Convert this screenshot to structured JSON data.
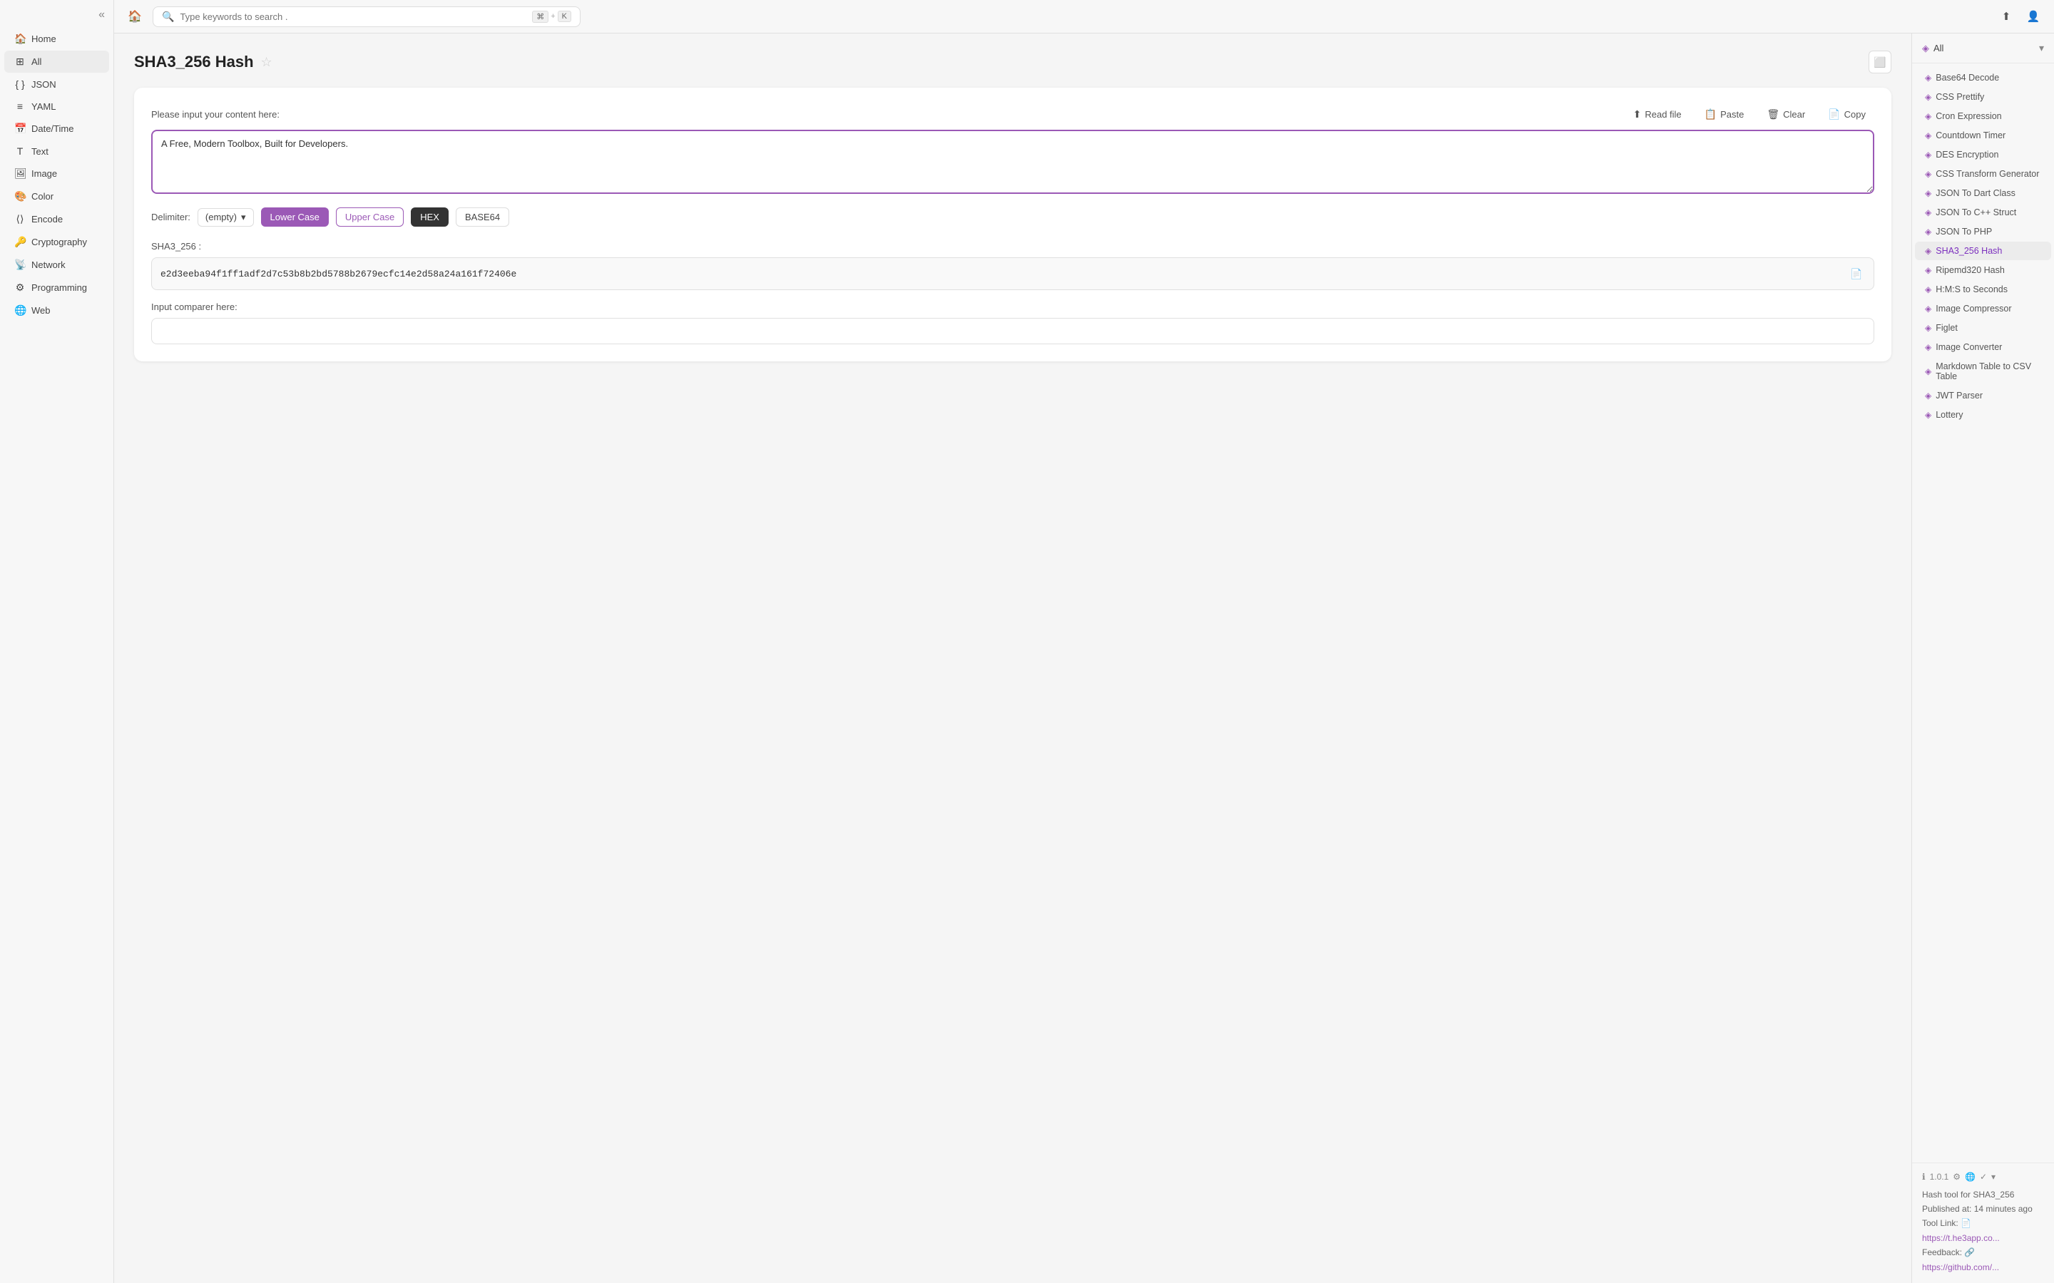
{
  "sidebar": {
    "items": [
      {
        "id": "home",
        "label": "Home",
        "icon": "🏠"
      },
      {
        "id": "all",
        "label": "All",
        "icon": "⊞",
        "active": true
      },
      {
        "id": "json",
        "label": "JSON",
        "icon": "{ }"
      },
      {
        "id": "yaml",
        "label": "YAML",
        "icon": "≡"
      },
      {
        "id": "datetime",
        "label": "Date/Time",
        "icon": "📅"
      },
      {
        "id": "text",
        "label": "Text",
        "icon": "T"
      },
      {
        "id": "image",
        "label": "Image",
        "icon": "🖼"
      },
      {
        "id": "color",
        "label": "Color",
        "icon": "🎨"
      },
      {
        "id": "encode",
        "label": "Encode",
        "icon": "⟨⟩"
      },
      {
        "id": "cryptography",
        "label": "Cryptography",
        "icon": "🔑"
      },
      {
        "id": "network",
        "label": "Network",
        "icon": "📡"
      },
      {
        "id": "programming",
        "label": "Programming",
        "icon": "⚙"
      },
      {
        "id": "web",
        "label": "Web",
        "icon": "🌐"
      }
    ]
  },
  "topbar": {
    "search_placeholder": "Type keywords to search .",
    "shortcut_symbol": "⌘",
    "shortcut_key": "K"
  },
  "tool": {
    "title": "SHA3_256 Hash",
    "input_label": "Please input your content here:",
    "input_value": "A Free, Modern Toolbox, Built for Developers.",
    "btn_read_file": "Read file",
    "btn_paste": "Paste",
    "btn_clear": "Clear",
    "btn_copy": "Copy",
    "delimiter_label": "Delimiter:",
    "delimiter_value": "(empty)",
    "case_lower": "Lower Case",
    "case_upper": "Upper Case",
    "format_hex": "HEX",
    "format_base64": "BASE64",
    "result_label": "SHA3_256 :",
    "result_value": "e2d3eeba94f1ff1adf2d7c53b8b2bd5788b2679ecfc14e2d58a24a161f72406e",
    "comparer_label": "Input comparer here:",
    "comparer_placeholder": ""
  },
  "right_panel": {
    "filter_label": "All",
    "items": [
      {
        "label": "Base64 Decode",
        "active": false
      },
      {
        "label": "CSS Prettify",
        "active": false
      },
      {
        "label": "Cron Expression",
        "active": false
      },
      {
        "label": "Countdown Timer",
        "active": false
      },
      {
        "label": "DES Encryption",
        "active": false
      },
      {
        "label": "CSS Transform Generator",
        "active": false
      },
      {
        "label": "JSON To Dart Class",
        "active": false
      },
      {
        "label": "JSON To C++ Struct",
        "active": false
      },
      {
        "label": "JSON To PHP",
        "active": false
      },
      {
        "label": "SHA3_256 Hash",
        "active": true
      },
      {
        "label": "Ripemd320 Hash",
        "active": false
      },
      {
        "label": "H:M:S to Seconds",
        "active": false
      },
      {
        "label": "Image Compressor",
        "active": false
      },
      {
        "label": "Figlet",
        "active": false
      },
      {
        "label": "Image Converter",
        "active": false
      },
      {
        "label": "Markdown Table to CSV Table",
        "active": false
      },
      {
        "label": "JWT Parser",
        "active": false
      },
      {
        "label": "Lottery",
        "active": false
      }
    ],
    "footer": {
      "version": "1.0.1",
      "description": "Hash tool for SHA3_256",
      "published": "Published at: 14 minutes ago",
      "tool_link_label": "Tool Link:",
      "tool_link": "https://t.he3app.co...",
      "feedback_label": "Feedback:",
      "feedback_link": "https://github.com/..."
    }
  }
}
